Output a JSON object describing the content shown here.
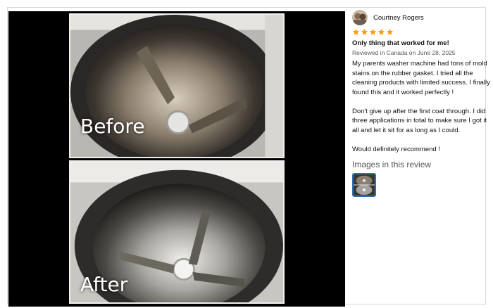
{
  "review": {
    "reviewer_name": "Courtney Rogers",
    "rating": 5,
    "max_rating": 5,
    "title": "Only thing that worked for me!",
    "meta": "Reviewed in Canada on June 28, 2025",
    "paragraphs": [
      "My parents washer machine had tons of mold stains on the rubber gasket. I tried all the cleaning products with limited success. I finally found this and it worked perfectly !",
      "Don't give up after the first coat through. I did three applications in total to make sure I got it all and let it sit for as long as I could.",
      "Would definitely recommend !"
    ],
    "images_heading": "Images in this review"
  },
  "photos": {
    "before_label": "Before",
    "after_label": "After"
  },
  "colors": {
    "star": "#ff9900",
    "thumb_border": "#2f6fb3",
    "text": "#0f1111",
    "muted": "#565959"
  }
}
